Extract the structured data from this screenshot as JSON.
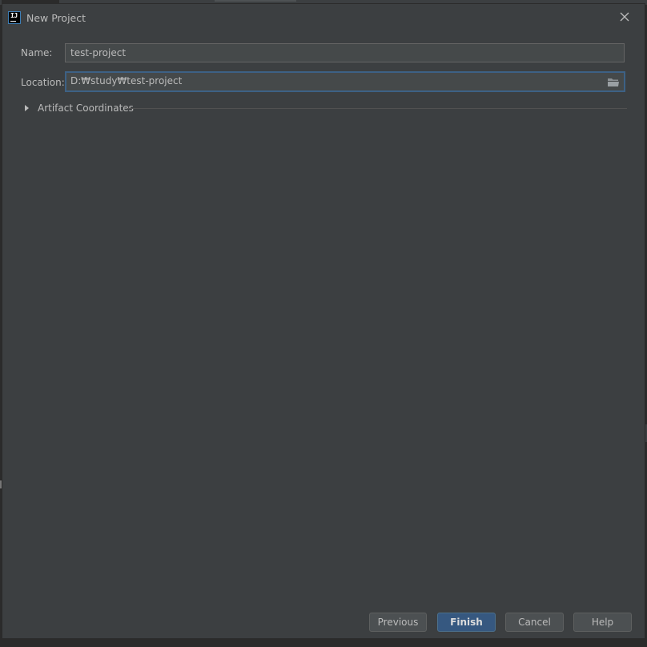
{
  "window": {
    "title": "New Project",
    "app_icon_text": "IJ"
  },
  "form": {
    "name_label": "Name:",
    "name_value": "test-project",
    "location_label": "Location:",
    "location_value": "D:₩study₩test-project"
  },
  "sections": {
    "artifact_coordinates": "Artifact Coordinates"
  },
  "buttons": {
    "previous": "Previous",
    "finish": "Finish",
    "cancel": "Cancel",
    "help": "Help"
  },
  "colors": {
    "dialog_background": "#3c3f41",
    "field_background": "#45494a",
    "focus_border": "#3d6185",
    "primary_button": "#365880",
    "text": "#bbbbbb"
  },
  "icons": {
    "app": "intellij-icon",
    "close": "close-icon",
    "browse": "folder-icon",
    "expand": "triangle-right-icon"
  }
}
